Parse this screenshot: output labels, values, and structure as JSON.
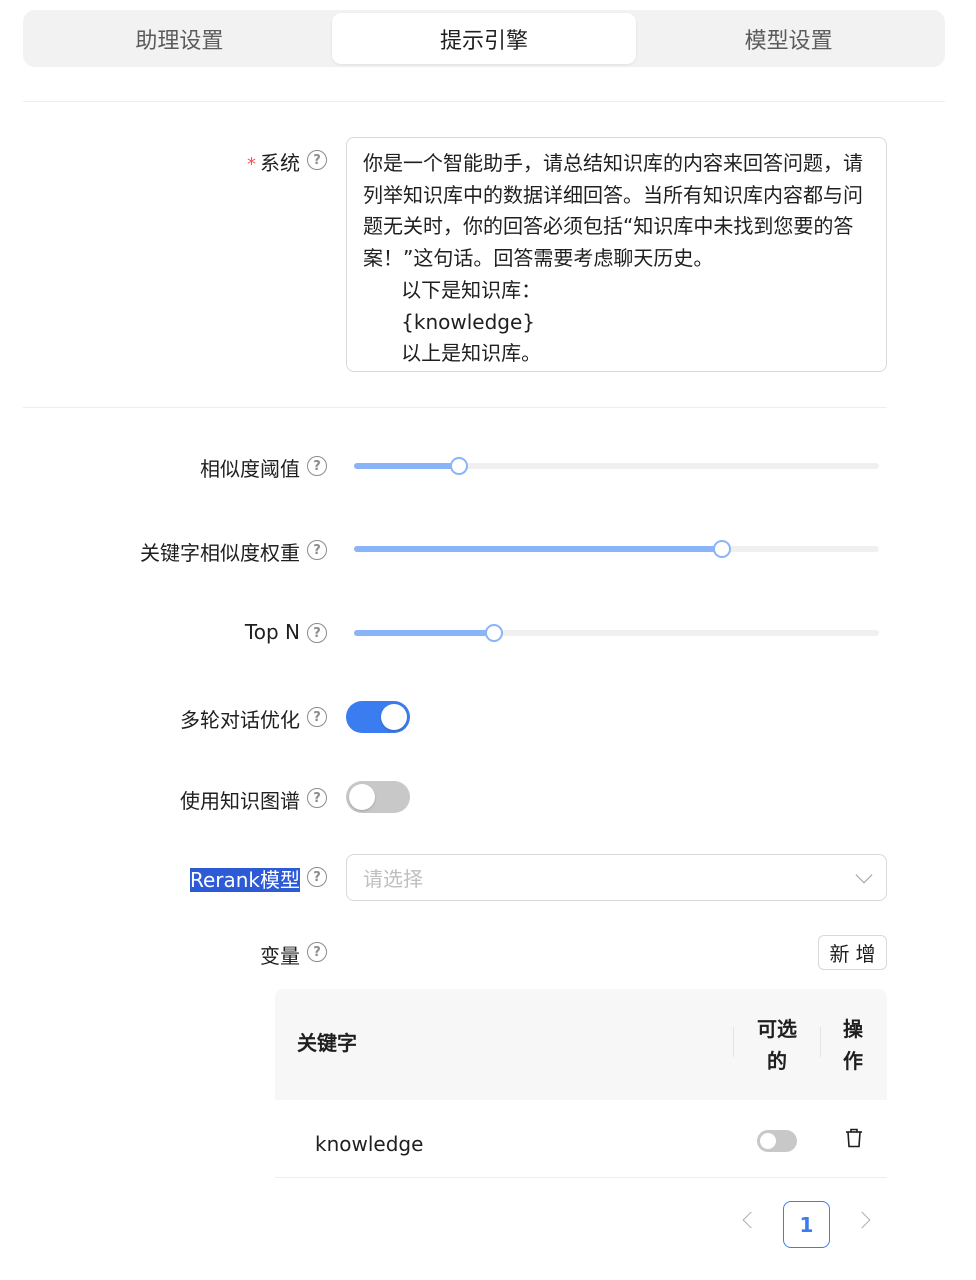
{
  "tabs": [
    {
      "label": "助理设置",
      "active": false
    },
    {
      "label": "提示引擎",
      "active": true
    },
    {
      "label": "模型设置",
      "active": false
    }
  ],
  "system": {
    "required_mark": "*",
    "label": "系统",
    "value": "你是一个智能助手，请总结知识库的内容来回答问题，请列举知识库中的数据详细回答。当所有知识库内容都与问题无关时，你的回答必须包括“知识库中未找到您要的答案！”这句话。回答需要考虑聊天历史。\n      以下是知识库：\n      {knowledge}\n      以上是知识库。"
  },
  "sliders": {
    "similarity": {
      "label": "相似度阈值",
      "level_fraction": 0.2
    },
    "keyword_weight": {
      "label": "关键字相似度权重",
      "level_fraction": 0.7
    },
    "top_n": {
      "label": "Top N",
      "level_fraction": 0.266
    }
  },
  "switches": {
    "multi_turn": {
      "label": "多轮对话优化",
      "on": true
    },
    "knowledge_graph": {
      "label": "使用知识图谱",
      "on": false
    }
  },
  "rerank": {
    "label": "Rerank模型",
    "placeholder": "请选择"
  },
  "variables": {
    "label": "变量",
    "add_button": "新增",
    "columns": {
      "key": "关键字",
      "optional": "可选\n的",
      "action": "操\n作"
    },
    "rows": [
      {
        "key": "knowledge",
        "optional": false
      }
    ]
  },
  "pagination": {
    "current": "1"
  },
  "colors": {
    "primary": "#3b7cf0",
    "slider_fill": "#8ab4f8",
    "required": "#ff4d4f",
    "highlight": "#2d5bd6"
  },
  "icons": {
    "help": "question-circle-icon",
    "delete": "trash-icon",
    "dropdown": "chevron-down-icon"
  }
}
